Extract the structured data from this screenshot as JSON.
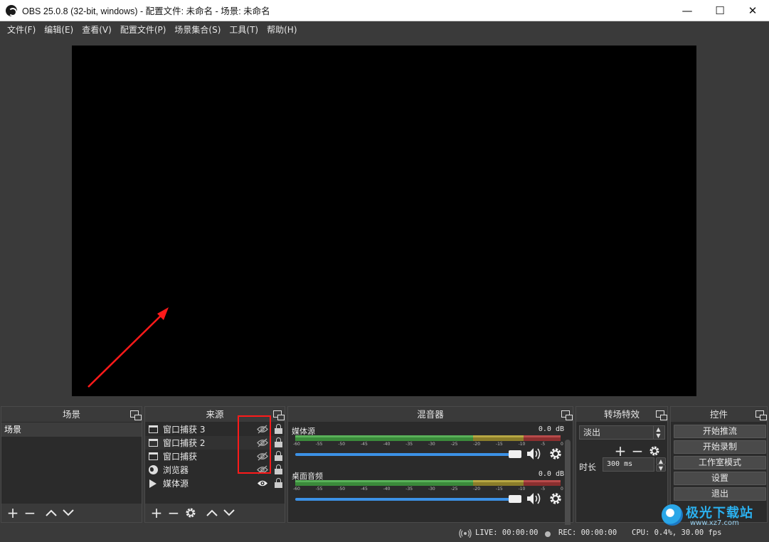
{
  "window": {
    "title": "OBS 25.0.8 (32-bit, windows) - 配置文件: 未命名 - 场景: 未命名",
    "minimize": "—",
    "maximize": "☐",
    "close": "✕"
  },
  "menu": [
    {
      "label": "文件(F)"
    },
    {
      "label": "编辑(E)"
    },
    {
      "label": "查看(V)"
    },
    {
      "label": "配置文件(P)"
    },
    {
      "label": "场景集合(S)"
    },
    {
      "label": "工具(T)"
    },
    {
      "label": "帮助(H)"
    }
  ],
  "scenes": {
    "title": "场景",
    "items": [
      {
        "label": "场景"
      }
    ]
  },
  "sources": {
    "title": "来源",
    "items": [
      {
        "label": "窗口捕获 3",
        "icon": "window-icon",
        "visible": false
      },
      {
        "label": "窗口捕获 2",
        "icon": "window-icon",
        "visible": false
      },
      {
        "label": "窗口捕获",
        "icon": "window-icon",
        "visible": false
      },
      {
        "label": "浏览器",
        "icon": "globe-icon",
        "visible": false
      },
      {
        "label": "媒体源",
        "icon": "play-icon",
        "visible": true
      }
    ]
  },
  "mixer": {
    "title": "混音器",
    "channels": [
      {
        "name": "媒体源",
        "db": "0.0 dB",
        "volume": 1.0
      },
      {
        "name": "桌面音频",
        "db": "0.0 dB",
        "volume": 1.0
      }
    ],
    "ticks": [
      "-60",
      "-55",
      "-50",
      "-45",
      "-40",
      "-35",
      "-30",
      "-25",
      "-20",
      "-15",
      "-10",
      "-5",
      "0"
    ]
  },
  "transitions": {
    "title": "转场特效",
    "selected": "淡出",
    "duration_label": "时长",
    "duration_value": "300 ms"
  },
  "controls": {
    "title": "控件",
    "buttons": [
      "开始推流",
      "开始录制",
      "工作室模式",
      "设置",
      "退出"
    ]
  },
  "status": {
    "live": "LIVE: 00:00:00",
    "rec": "REC: 00:00:00",
    "cpu": "CPU: 0.4%, 30.00 fps"
  },
  "watermark": {
    "text": "极光下载站",
    "url": "www.xz7.com"
  },
  "colors": {
    "annotation": "#ff1a1a",
    "volume_bar": "#3c91e6",
    "meter_green": "#3b8a3b",
    "meter_yellow": "#8a7c2a",
    "meter_red": "#8a2f2f"
  }
}
